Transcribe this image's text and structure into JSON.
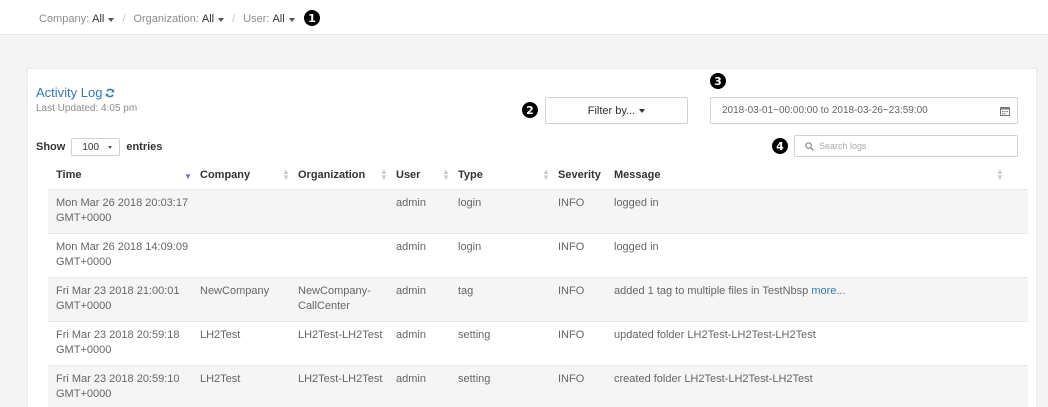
{
  "filters": {
    "company_label": "Company:",
    "company_value": "All",
    "organization_label": "Organization:",
    "organization_value": "All",
    "user_label": "User:",
    "user_value": "All",
    "separator": "/"
  },
  "callouts": [
    "1",
    "2",
    "3",
    "4"
  ],
  "panel": {
    "title": "Activity Log",
    "last_updated": "Last Updated: 4:05 pm",
    "filter_button": "Filter by...",
    "date_range": "2018-03-01~00:00:00 to 2018-03-26~23:59:00",
    "show_label": "Show",
    "entries_value": "100",
    "entries_label": "entries",
    "search_placeholder": "Search logs"
  },
  "table": {
    "columns": [
      "Time",
      "Company",
      "Organization",
      "User",
      "Type",
      "Severity",
      "Message"
    ],
    "rows": [
      {
        "time": "Mon Mar 26 2018 20:03:17 GMT+0000",
        "company": "",
        "organization": "",
        "user": "admin",
        "type": "login",
        "severity": "INFO",
        "message": "logged in",
        "more": ""
      },
      {
        "time": "Mon Mar 26 2018 14:09:09 GMT+0000",
        "company": "",
        "organization": "",
        "user": "admin",
        "type": "login",
        "severity": "INFO",
        "message": "logged in",
        "more": ""
      },
      {
        "time": "Fri Mar 23 2018 21:00:01 GMT+0000",
        "company": "NewCompany",
        "organization": "NewCompany-CallCenter",
        "user": "admin",
        "type": "tag",
        "severity": "INFO",
        "message": "added 1 tag to multiple files in TestNbsp",
        "more": "more..."
      },
      {
        "time": "Fri Mar 23 2018 20:59:18 GMT+0000",
        "company": "LH2Test",
        "organization": "LH2Test-LH2Test",
        "user": "admin",
        "type": "setting",
        "severity": "INFO",
        "message": "updated folder LH2Test-LH2Test-LH2Test",
        "more": ""
      },
      {
        "time": "Fri Mar 23 2018 20:59:10 GMT+0000",
        "company": "LH2Test",
        "organization": "LH2Test-LH2Test",
        "user": "admin",
        "type": "setting",
        "severity": "INFO",
        "message": "created folder LH2Test-LH2Test-LH2Test",
        "more": ""
      }
    ]
  },
  "colors": {
    "accent": "#337ab7",
    "sort_active": "#6b6fc9",
    "row_stripe": "#f5f5f5"
  }
}
